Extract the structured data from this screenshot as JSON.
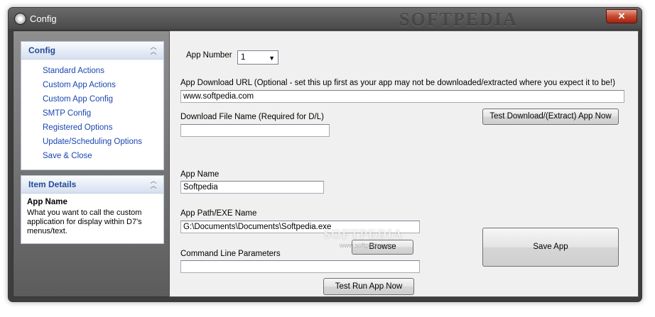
{
  "window": {
    "title": "Config",
    "watermark": "SOFTPEDIA",
    "close_glyph": "✕"
  },
  "sidebar": {
    "config_panel": {
      "title": "Config",
      "items": [
        {
          "label": "Standard Actions"
        },
        {
          "label": "Custom App Actions"
        },
        {
          "label": "Custom App Config"
        },
        {
          "label": "SMTP Config"
        },
        {
          "label": "Registered Options"
        },
        {
          "label": "Update/Scheduling Options"
        },
        {
          "label": "Save & Close"
        }
      ]
    },
    "details_panel": {
      "title": "Item Details",
      "item_name": "App Name",
      "item_description": "What you want to call the custom application for display within D7's menus/text."
    }
  },
  "form": {
    "app_number_label": "App Number",
    "app_number_value": "1",
    "download_url_label": "App Download URL (Optional - set this up first as your app may not be downloaded/extracted where you expect it to be!)",
    "download_url_value": "www.softpedia.com",
    "test_download_label": "Test Download/(Extract) App Now",
    "download_file_label": "Download File Name (Required for D/L)",
    "download_file_value": "",
    "app_name_label": "App Name",
    "app_name_value": "Softpedia",
    "app_path_label": "App Path/EXE Name",
    "app_path_value": "G:\\Documents\\Documents\\Softpedia.exe",
    "browse_label": "Browse",
    "save_app_label": "Save App",
    "cmd_params_label": "Command Line Parameters",
    "cmd_params_value": "",
    "test_run_label": "Test Run App Now"
  },
  "overlay": {
    "watermark": "SOFTPEDIA",
    "watermark_sub": "www.softpedia.com"
  }
}
